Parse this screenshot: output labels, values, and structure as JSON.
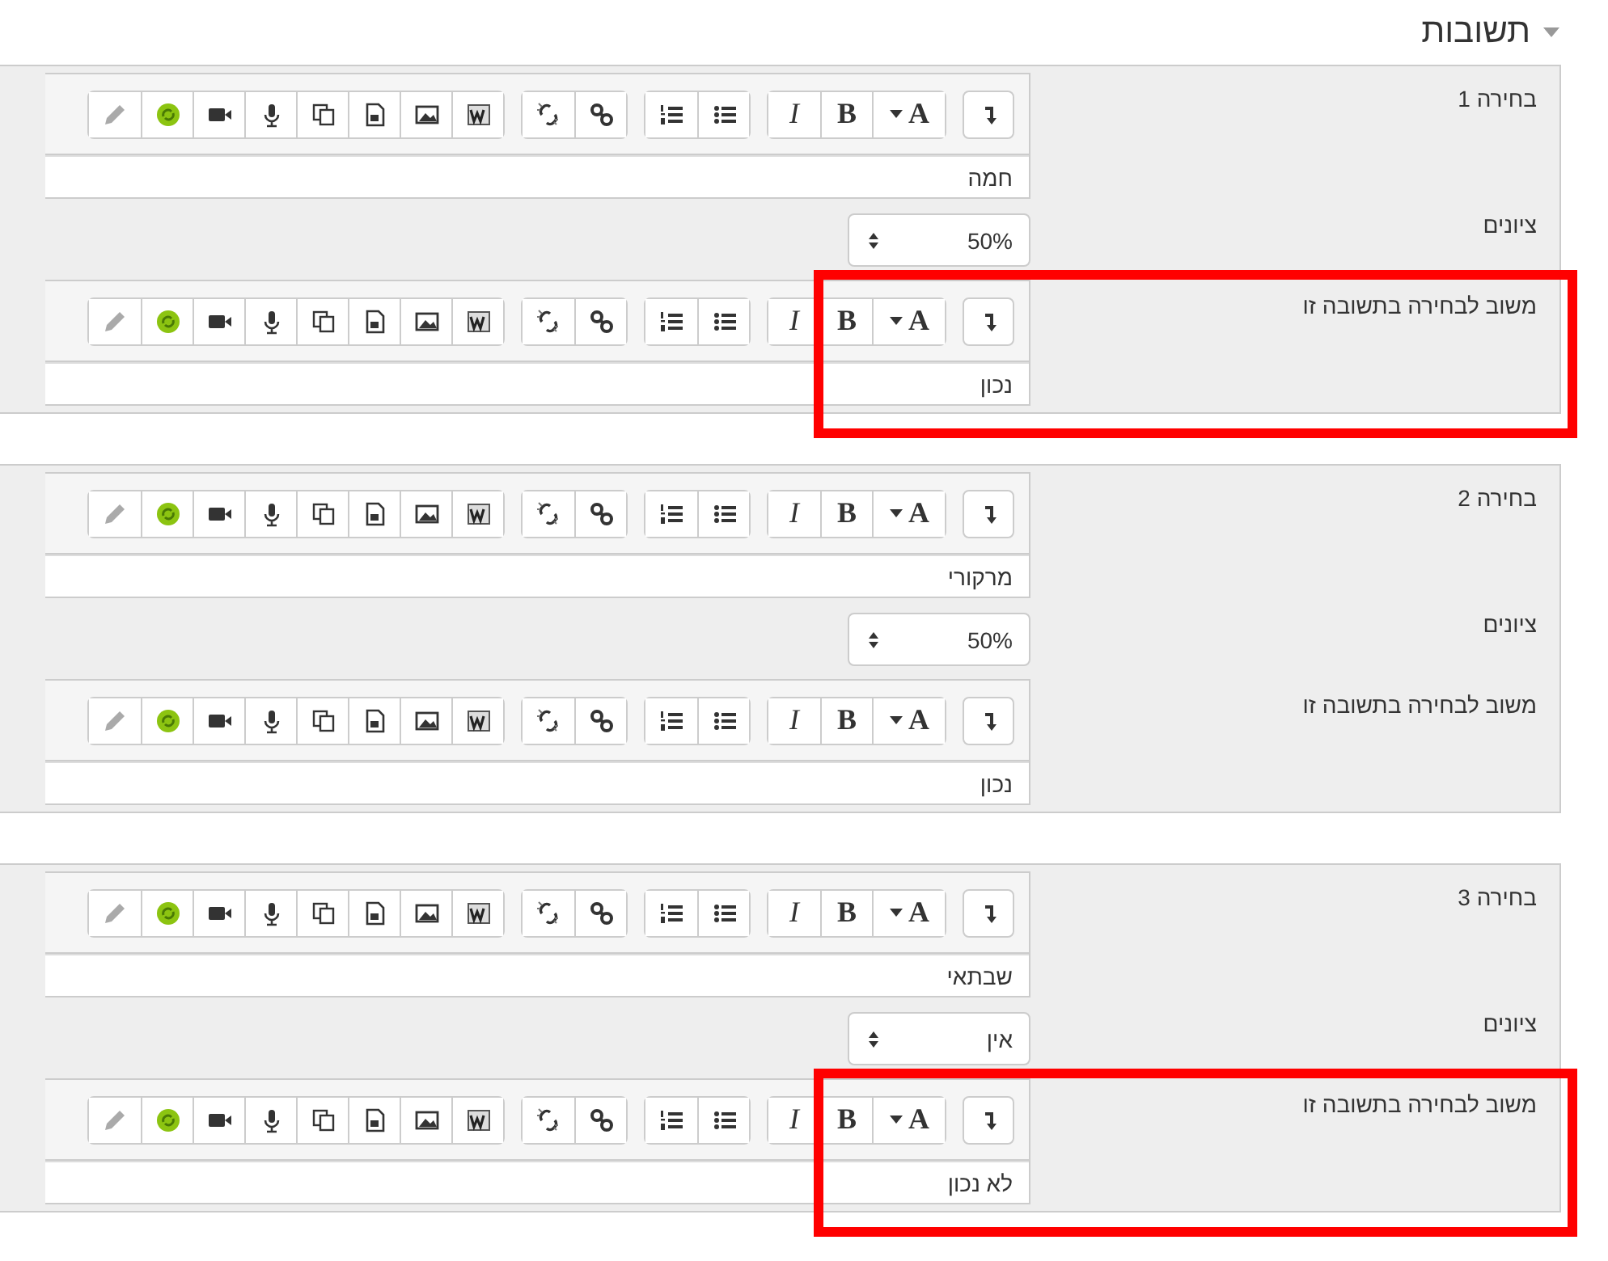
{
  "section": {
    "title": "תשובות",
    "expanded": true
  },
  "choices": [
    {
      "label": "בחירה 1",
      "answer": {
        "toolbar": {
          "font": "A",
          "bold": "B",
          "italic": "I"
        },
        "text": "חמה"
      },
      "grade": {
        "label": "ציונים",
        "value": "50%"
      },
      "feedback": {
        "label": "משוב לבחירה בתשובה זו",
        "toolbar": {
          "font": "A",
          "bold": "B",
          "italic": "I"
        },
        "text": "נכון",
        "highlighted": true
      }
    },
    {
      "label": "בחירה 2",
      "answer": {
        "toolbar": {
          "font": "A",
          "bold": "B",
          "italic": "I"
        },
        "text": "מרקורי"
      },
      "grade": {
        "label": "ציונים",
        "value": "50%"
      },
      "feedback": {
        "label": "משוב לבחירה בתשובה זו",
        "toolbar": {
          "font": "A",
          "bold": "B",
          "italic": "I"
        },
        "text": "נכון",
        "highlighted": false
      }
    },
    {
      "label": "בחירה 3",
      "answer": {
        "toolbar": {
          "font": "A",
          "bold": "B",
          "italic": "I"
        },
        "text": "שבתאי"
      },
      "grade": {
        "label": "ציונים",
        "value": "אין"
      },
      "feedback": {
        "label": "משוב לבחירה בתשובה זו",
        "toolbar": {
          "font": "A",
          "bold": "B",
          "italic": "I"
        },
        "text": "לא נכון",
        "highlighted": true
      }
    }
  ]
}
